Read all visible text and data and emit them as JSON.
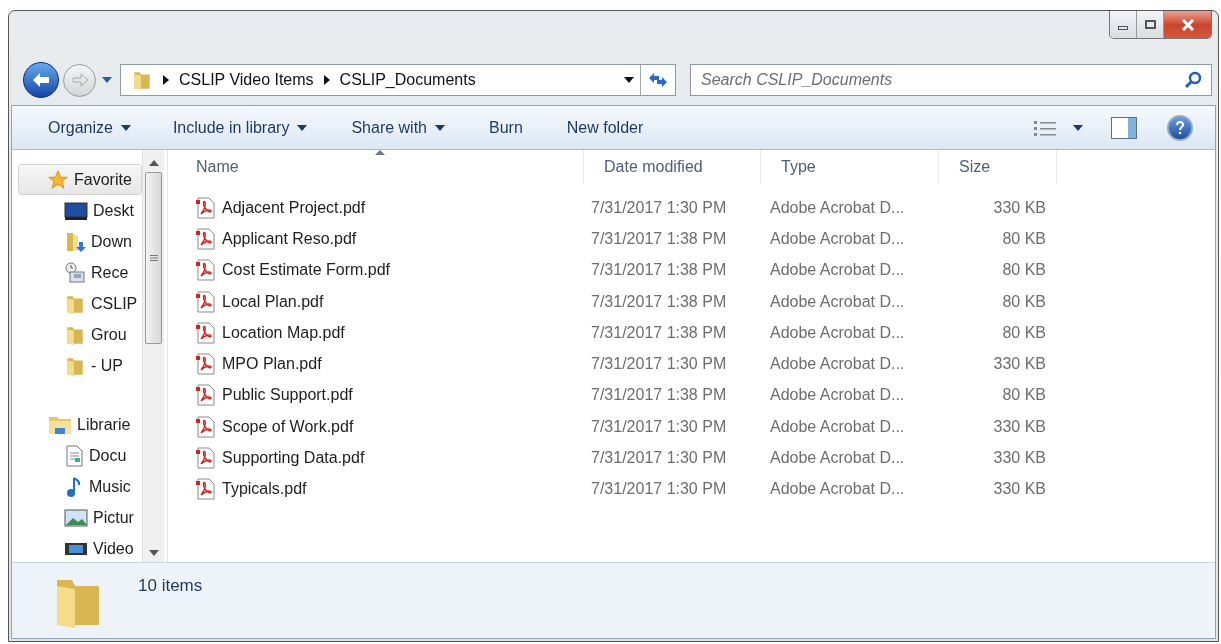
{
  "address_bar": {
    "breadcrumbs": [
      "CSLIP Video Items",
      "CSLIP_Documents"
    ]
  },
  "search": {
    "placeholder": "Search CSLIP_Documents"
  },
  "toolbar": {
    "commands": [
      {
        "label": "Organize",
        "dropdown": true
      },
      {
        "label": "Include in library",
        "dropdown": true
      },
      {
        "label": "Share with",
        "dropdown": true
      },
      {
        "label": "Burn",
        "dropdown": false
      },
      {
        "label": "New folder",
        "dropdown": false
      }
    ]
  },
  "sidebar": {
    "items": [
      {
        "label": "Favorite",
        "kind": "star",
        "selected": true,
        "children": [
          {
            "label": "Deskt",
            "kind": "desktop",
            "selected": false
          },
          {
            "label": "Down",
            "kind": "downloads",
            "selected": false
          },
          {
            "label": "Rece",
            "kind": "recent",
            "selected": false
          },
          {
            "label": "CSLIP",
            "kind": "folder",
            "selected": false
          },
          {
            "label": "Grou",
            "kind": "folder",
            "selected": false
          },
          {
            "label": "- UP",
            "kind": "folder",
            "selected": false
          }
        ]
      },
      {
        "label": "Librarie",
        "kind": "library",
        "selected": false,
        "children": [
          {
            "label": "Docu",
            "kind": "document",
            "selected": false
          },
          {
            "label": "Music",
            "kind": "music",
            "selected": false
          },
          {
            "label": "Pictur",
            "kind": "pictures",
            "selected": false
          },
          {
            "label": "Video",
            "kind": "video",
            "selected": false
          }
        ]
      }
    ]
  },
  "table": {
    "columns": [
      {
        "label": "Name",
        "sorted": true
      },
      {
        "label": "Date modified",
        "sorted": false
      },
      {
        "label": "Type",
        "sorted": false
      },
      {
        "label": "Size",
        "sorted": false
      }
    ],
    "rows": [
      {
        "name": "Adjacent Project.pdf",
        "date": "7/31/2017 1:30 PM",
        "type": "Adobe Acrobat D...",
        "size": "330 KB"
      },
      {
        "name": "Applicant Reso.pdf",
        "date": "7/31/2017 1:38 PM",
        "type": "Adobe Acrobat D...",
        "size": "80 KB"
      },
      {
        "name": "Cost Estimate Form.pdf",
        "date": "7/31/2017 1:38 PM",
        "type": "Adobe Acrobat D...",
        "size": "80 KB"
      },
      {
        "name": "Local Plan.pdf",
        "date": "7/31/2017 1:38 PM",
        "type": "Adobe Acrobat D...",
        "size": "80 KB"
      },
      {
        "name": "Location Map.pdf",
        "date": "7/31/2017 1:38 PM",
        "type": "Adobe Acrobat D...",
        "size": "80 KB"
      },
      {
        "name": "MPO Plan.pdf",
        "date": "7/31/2017 1:30 PM",
        "type": "Adobe Acrobat D...",
        "size": "330 KB"
      },
      {
        "name": "Public Support.pdf",
        "date": "7/31/2017 1:38 PM",
        "type": "Adobe Acrobat D...",
        "size": "80 KB"
      },
      {
        "name": "Scope of Work.pdf",
        "date": "7/31/2017 1:30 PM",
        "type": "Adobe Acrobat D...",
        "size": "330 KB"
      },
      {
        "name": "Supporting Data.pdf",
        "date": "7/31/2017 1:30 PM",
        "type": "Adobe Acrobat D...",
        "size": "330 KB"
      },
      {
        "name": "Typicals.pdf",
        "date": "7/31/2017 1:30 PM",
        "type": "Adobe Acrobat D...",
        "size": "330 KB"
      }
    ]
  },
  "status_bar": {
    "count": "10 items"
  }
}
